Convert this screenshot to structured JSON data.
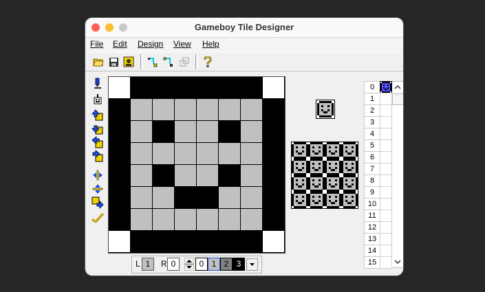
{
  "window": {
    "title": "Gameboy Tile Designer"
  },
  "menu": {
    "file": "File",
    "edit": "Edit",
    "design": "Design",
    "view": "View",
    "help": "Help"
  },
  "palette": [
    "#ffffff",
    "#c0c0c0",
    "#808080",
    "#000000"
  ],
  "tile": {
    "pixels": [
      "03333330",
      "31111113",
      "31311313",
      "31111113",
      "31311313",
      "31133113",
      "31111113",
      "03333330"
    ]
  },
  "bottom_bar": {
    "left_label": "L",
    "left_value": "1",
    "right_label": "R",
    "right_value": "0",
    "colors": [
      "0",
      "1",
      "2",
      "3"
    ]
  },
  "tile_list": {
    "indices": [
      "0",
      "1",
      "2",
      "3",
      "4",
      "5",
      "6",
      "7",
      "8",
      "9",
      "10",
      "11",
      "12",
      "13",
      "14",
      "15"
    ],
    "selected": "0"
  },
  "icons": {
    "toolbar": [
      "open-folder-icon",
      "save-icon",
      "save-all-icon",
      "copy-tile-icon",
      "paste-tile-icon",
      "duplicate-icon",
      "help-icon"
    ],
    "left": [
      "pen-icon",
      "fill-icon",
      "shift-up-icon",
      "shift-down-icon",
      "shift-left-icon",
      "shift-right-icon",
      "flip-horizontal-icon",
      "flip-vertical-icon",
      "rotate-icon",
      "clear-icon"
    ]
  }
}
